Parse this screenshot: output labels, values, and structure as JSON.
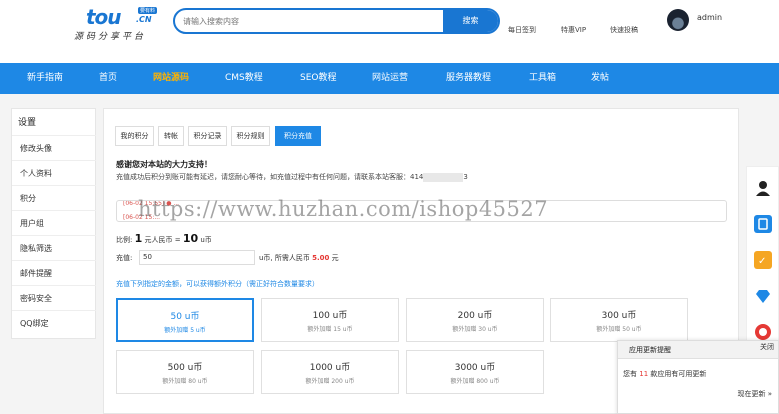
{
  "header": {
    "logo_main": "tou",
    "logo_cn": ".CN",
    "logo_badge": "要有料",
    "logo_sub": "源码分享平台",
    "search_placeholder": "请输入搜索内容",
    "search_button": "搜索",
    "links": [
      "每日签到",
      "特惠VIP",
      "快速投稿"
    ],
    "username": "admin"
  },
  "nav": {
    "items": [
      "新手指南",
      "首页",
      "网站源码",
      "CMS教程",
      "SEO教程",
      "网站运营",
      "服务器教程",
      "工具箱",
      "发帖"
    ],
    "active": "网站源码",
    "color": "#1e88e5",
    "active_color": "#ffb300"
  },
  "sidebar": {
    "title": "设置",
    "items": [
      "修改头像",
      "个人资料",
      "积分",
      "用户组",
      "隐私筛选",
      "邮件提醒",
      "密码安全",
      "QQ绑定"
    ]
  },
  "tabs": [
    "我的积分",
    "转帐",
    "积分记录",
    "积分规则",
    "积分充值"
  ],
  "active_tab": "积分充值",
  "recharge": {
    "thanks": "感谢您对本站的大力支持！",
    "notice": "充值成功后积分到账可能有延迟，请您耐心等待，如充值过程中有任何问题，请联系本站客服：414",
    "notice_tail": "3",
    "ticker_line1": "[06-02 15:55] ● ...",
    "ticker_line2": "[06-02 15:...",
    "ratio_label": "比例:",
    "ratio_rmb": "1",
    "ratio_rmb_unit": "元人民币 =",
    "ratio_coin": "10",
    "ratio_coin_unit": "u币",
    "charge_label": "充值:",
    "charge_value": "50",
    "charge_unit": "u币, 所需人民币",
    "charge_money": "5.00",
    "charge_money_unit": "元",
    "hint": "充值下列指定的金额，可以获得额外积分（需正好符合数量要求）",
    "options": [
      {
        "amount": "50 u币",
        "bonus": "额外加赠 5 u币",
        "selected": true
      },
      {
        "amount": "100 u币",
        "bonus": "额外加赠 15 u币",
        "selected": false
      },
      {
        "amount": "200 u币",
        "bonus": "额外加赠 30 u币",
        "selected": false
      },
      {
        "amount": "300 u币",
        "bonus": "额外加赠 50 u币",
        "selected": false
      },
      {
        "amount": "500 u币",
        "bonus": "额外加赠 80 u币",
        "selected": false
      },
      {
        "amount": "1000 u币",
        "bonus": "额外加赠 200 u币",
        "selected": false
      },
      {
        "amount": "3000 u币",
        "bonus": "额外加赠 800 u币",
        "selected": false
      }
    ]
  },
  "watermark": "https://www.huzhan.com/ishop45527",
  "right_toolbar": {
    "icons": [
      "user-service-icon",
      "app-store-icon",
      "sign-in-icon",
      "diamond-icon",
      "weibo-icon"
    ],
    "colors": [
      "#222222",
      "#1e88e5",
      "#f5a623",
      "#1e88e5",
      "#e53935"
    ]
  },
  "popup": {
    "title": "应用更新提醒",
    "close": "关闭",
    "body_prefix": "您有",
    "body_count": "11",
    "body_suffix": "款应用有可用更新",
    "link": "现在更新 »"
  }
}
